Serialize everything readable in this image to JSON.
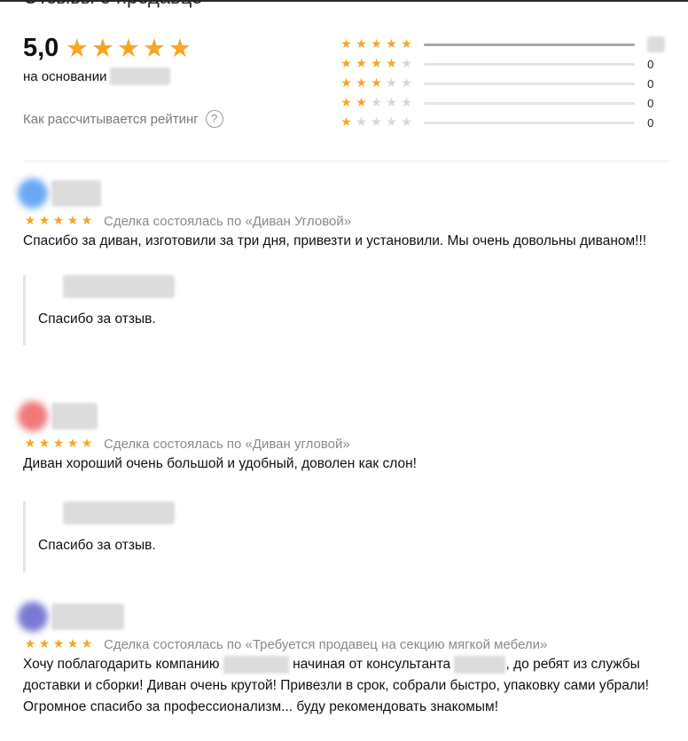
{
  "section_title": "Отзывы о продавце",
  "summary": {
    "score": "5,0",
    "stars": 5,
    "based_on_label": "на основании",
    "how_calculated": "Как рассчитывается рейтинг",
    "help_icon": "question-circle-icon"
  },
  "distribution": [
    {
      "stars": 5,
      "fraction": 1.0,
      "count": ""
    },
    {
      "stars": 4,
      "fraction": 0,
      "count": "0"
    },
    {
      "stars": 3,
      "fraction": 0,
      "count": "0"
    },
    {
      "stars": 2,
      "fraction": 0,
      "count": "0"
    },
    {
      "stars": 1,
      "fraction": 0,
      "count": "0"
    }
  ],
  "colors": {
    "star": "#f5a623",
    "star_empty": "#d6d6d6",
    "muted_text": "#8a8a8a"
  },
  "reviews": [
    {
      "avatar_color": "#6aa8f5",
      "rating": 5,
      "deal": "Сделка состоялась по «Диван Угловой»",
      "text": "Спасибо за диван, изготовили за три дня, привезти и установили. Мы очень довольны диваном!!!",
      "reply": "Спасибо за отзыв."
    },
    {
      "avatar_color": "#f07a7a",
      "rating": 5,
      "deal": "Сделка состоялась по «Диван угловой»",
      "text": "Диван хороший очень большой и удобный, доволен как слон!",
      "reply": "Спасибо за отзыв."
    },
    {
      "avatar_color": "#7a7ad6",
      "rating": 5,
      "deal": "Сделка состоялась по «Требуется продавец на секцию мягкой мебели»",
      "text_part1": "Хочу поблагодарить компанию",
      "text_part2": "начиная от консультанта",
      "text_part3": ", до ребят из службы доставки и сборки! Диван очень крутой! Привезли в срок, собрали быстро, упаковку сами убрали! Огромное спасибо за профессионализм... буду рекомендовать знакомым!"
    }
  ]
}
